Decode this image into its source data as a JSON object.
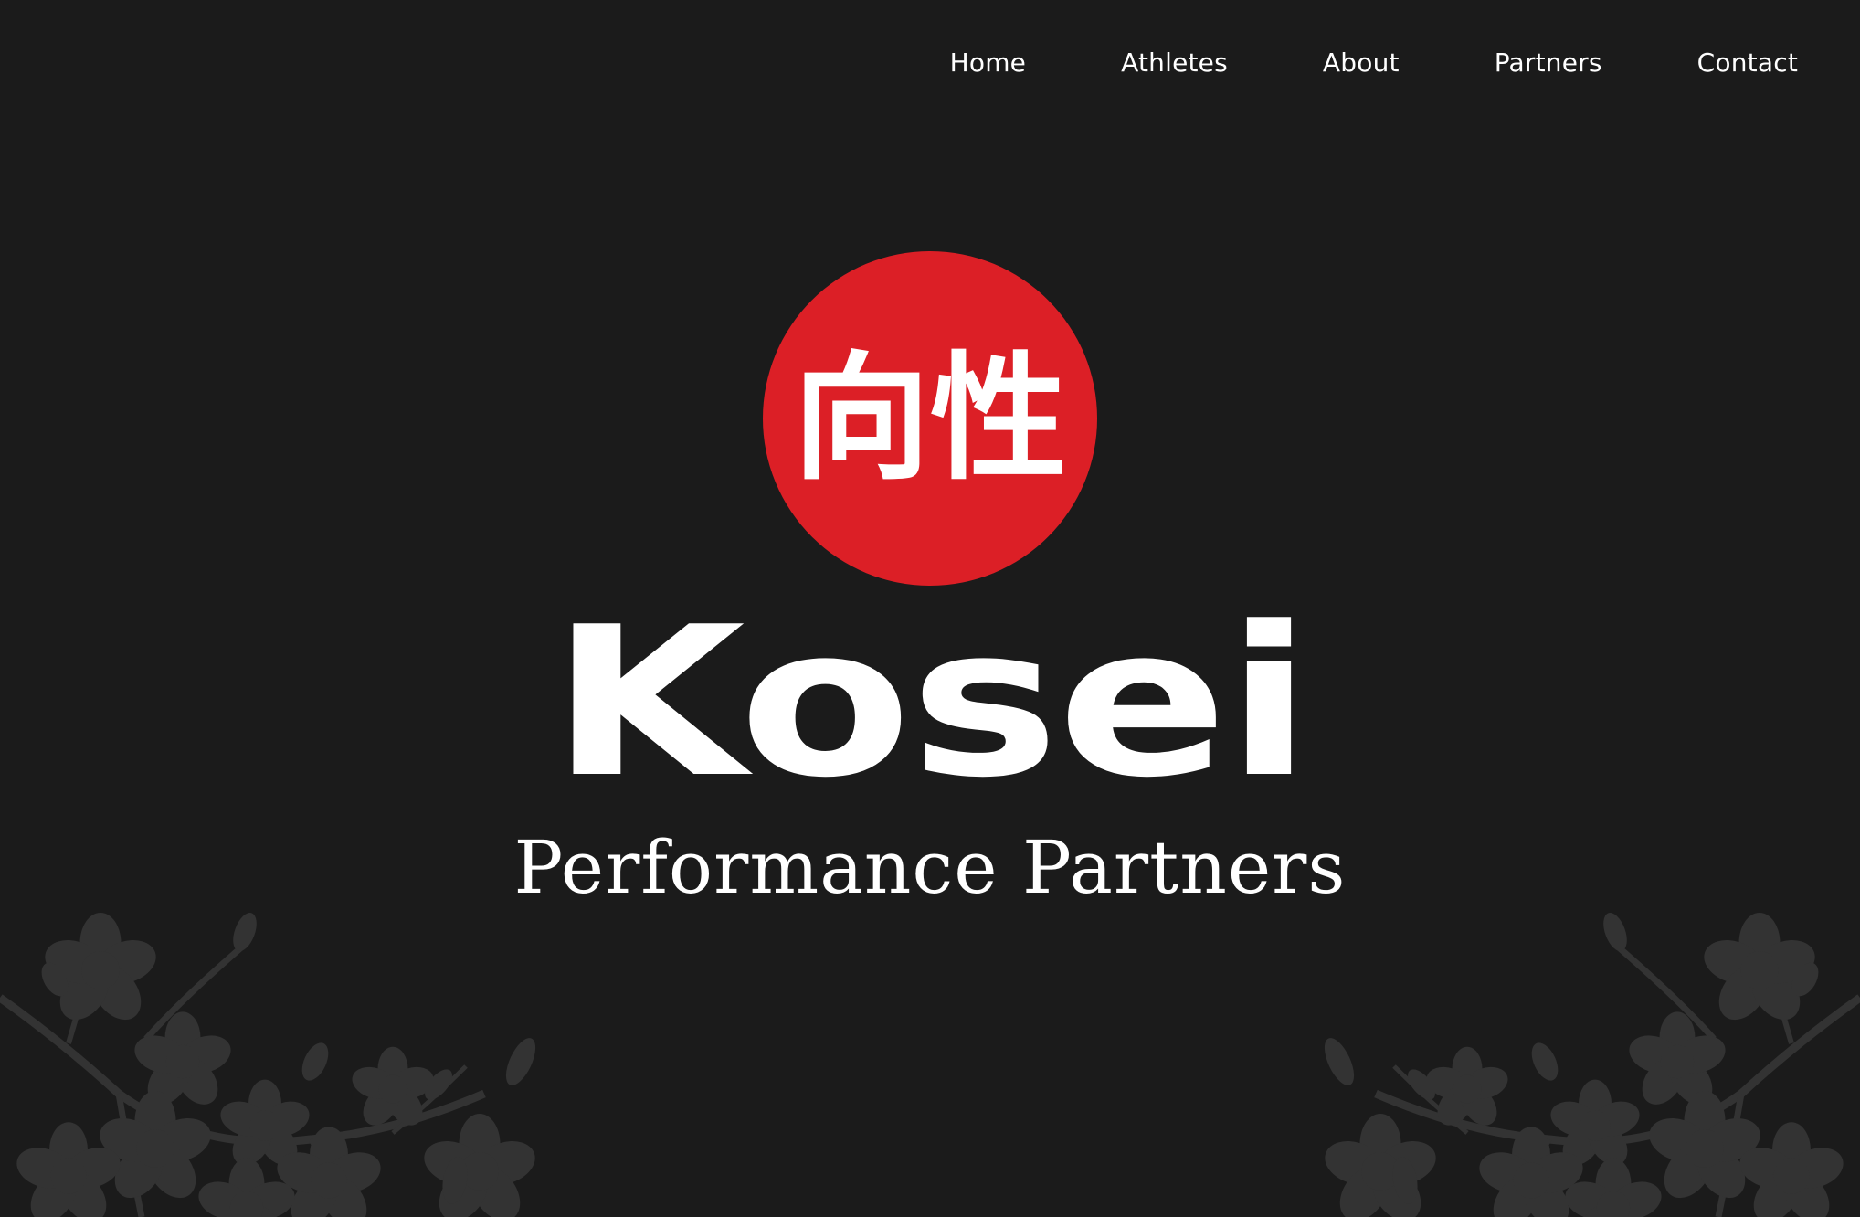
{
  "nav": {
    "items": [
      {
        "label": "Home"
      },
      {
        "label": "Athletes"
      },
      {
        "label": "About"
      },
      {
        "label": "Partners"
      },
      {
        "label": "Contact"
      }
    ]
  },
  "hero": {
    "logo_kanji": "向性",
    "brand_name": "Kosei",
    "tagline": "Performance Partners"
  },
  "colors": {
    "background": "#1b1b1b",
    "accent_red": "#dc1f26",
    "text": "#ffffff",
    "blossom": "#333333"
  },
  "icons": {
    "logo_mark": "red-sun-circle-icon",
    "decoration": "cherry-blossom-branch-icon"
  }
}
